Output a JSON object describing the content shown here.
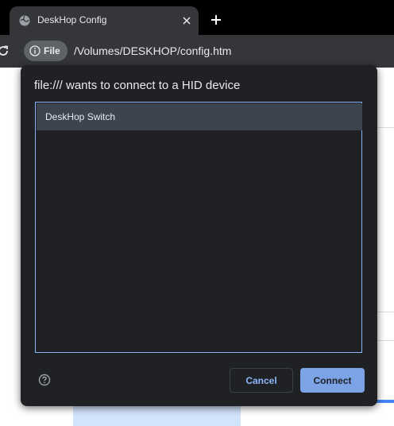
{
  "tab": {
    "title": "DeskHop Config",
    "favicon": "globe-icon"
  },
  "toolbar": {
    "chip_label": "File",
    "chip_icon": "info-icon",
    "url": "/Volumes/DESKHOP/config.htm"
  },
  "dialog": {
    "title": "file:/// wants to connect to a HID device",
    "devices": [
      {
        "label": "DeskHop Switch",
        "selected": true
      }
    ],
    "cancel_label": "Cancel",
    "connect_label": "Connect",
    "help_icon": "help-circle-icon"
  },
  "colors": {
    "dialog_bg": "#202124",
    "accent": "#8ab4f8",
    "connect_bg": "#7ba3e6",
    "selected_row": "#3c4450"
  }
}
